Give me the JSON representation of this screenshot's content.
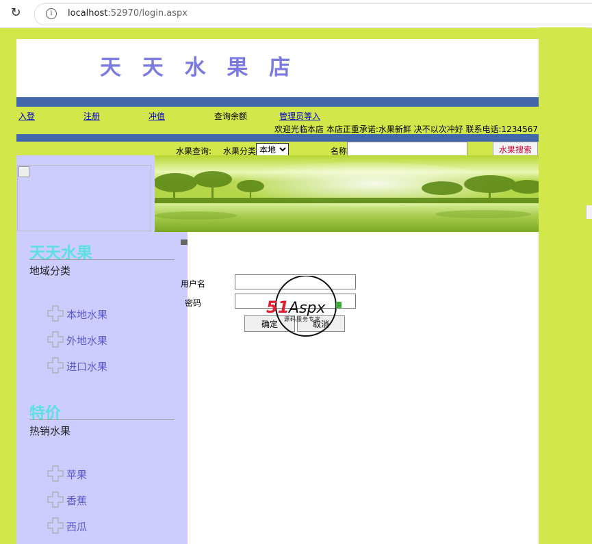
{
  "browser": {
    "url_host": "localhost",
    "url_rest": ":52970/login.aspx"
  },
  "header": {
    "title": "天 天 水 果 店"
  },
  "nav": {
    "login": "入登",
    "register": "注册",
    "recharge": "冲值",
    "balance": "查询余额",
    "admin_login": "管理员等入"
  },
  "welcome": "欢迎光临本店 本店正重承诺:水果新鲜 决不以次冲好 联系电话:1234567",
  "search": {
    "label": "水果查询:",
    "category_label": "水果分类",
    "category_value": "本地",
    "name_label": "名称",
    "name_value": "",
    "button": "水果搜索"
  },
  "sidebar": {
    "section1": {
      "title": "天天水果",
      "subtitle": "地域分类",
      "items": [
        "本地水果",
        "外地水果",
        "进口水果"
      ]
    },
    "section2": {
      "title": "特价",
      "subtitle": "热销水果",
      "items": [
        "苹果",
        "香蕉",
        "西瓜"
      ]
    }
  },
  "login_form": {
    "username_label": "用户名",
    "password_label": "密码",
    "username_value": "",
    "password_value": "",
    "confirm_button": "确定",
    "cancel_button": "取消"
  },
  "watermark": {
    "brand": "51Aspx",
    "tagline": "源码服务专家"
  },
  "colors": {
    "page_bg": "#d2e84a",
    "bar_blue": "#4466aa",
    "sidebar_bg": "#ccccff",
    "title_color": "#7a7ae0",
    "section_title": "#5ee0e0",
    "link_color": "#5b5bcc"
  }
}
